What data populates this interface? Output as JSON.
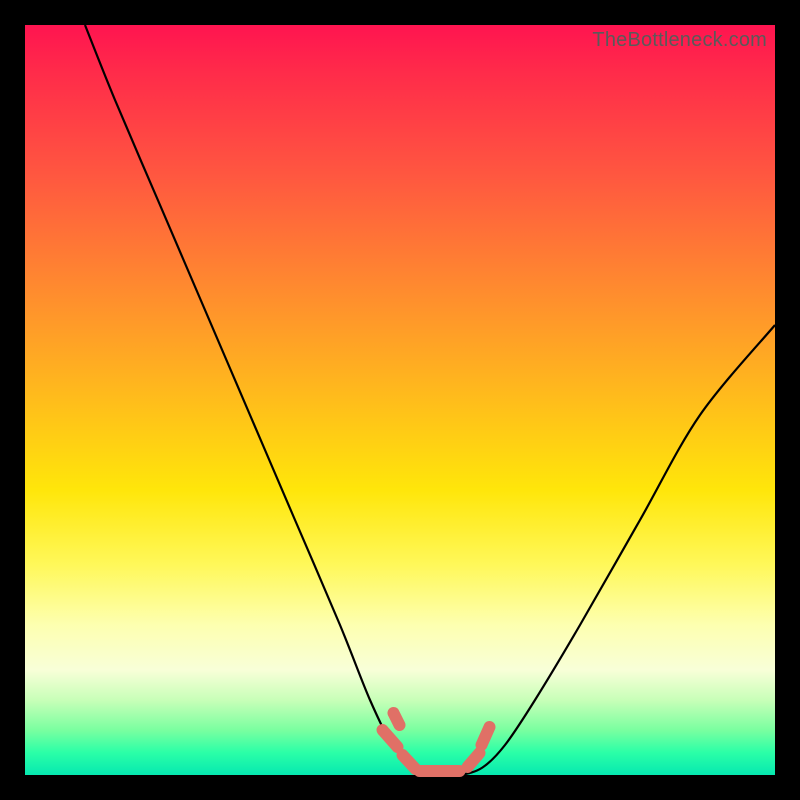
{
  "watermark": "TheBottleneck.com",
  "chart_data": {
    "type": "line",
    "title": "",
    "xlabel": "",
    "ylabel": "",
    "xlim": [
      0,
      100
    ],
    "ylim": [
      0,
      100
    ],
    "series": [
      {
        "name": "bottleneck-curve",
        "x": [
          8,
          12,
          18,
          24,
          30,
          36,
          42,
          46,
          49,
          52,
          55,
          58,
          61,
          64,
          68,
          74,
          82,
          90,
          100
        ],
        "values": [
          100,
          90,
          76,
          62,
          48,
          34,
          20,
          10,
          4,
          1,
          0,
          0,
          1,
          4,
          10,
          20,
          34,
          48,
          60
        ]
      }
    ],
    "annotations": [
      {
        "name": "valley-dash-cluster",
        "x": 55,
        "y": 2
      }
    ],
    "gradient_stops": [
      {
        "pos": 0.0,
        "color": "#ff1450"
      },
      {
        "pos": 0.35,
        "color": "#ff8a2f"
      },
      {
        "pos": 0.62,
        "color": "#ffe60a"
      },
      {
        "pos": 0.86,
        "color": "#f8ffd8"
      },
      {
        "pos": 1.0,
        "color": "#06e9b0"
      }
    ]
  }
}
